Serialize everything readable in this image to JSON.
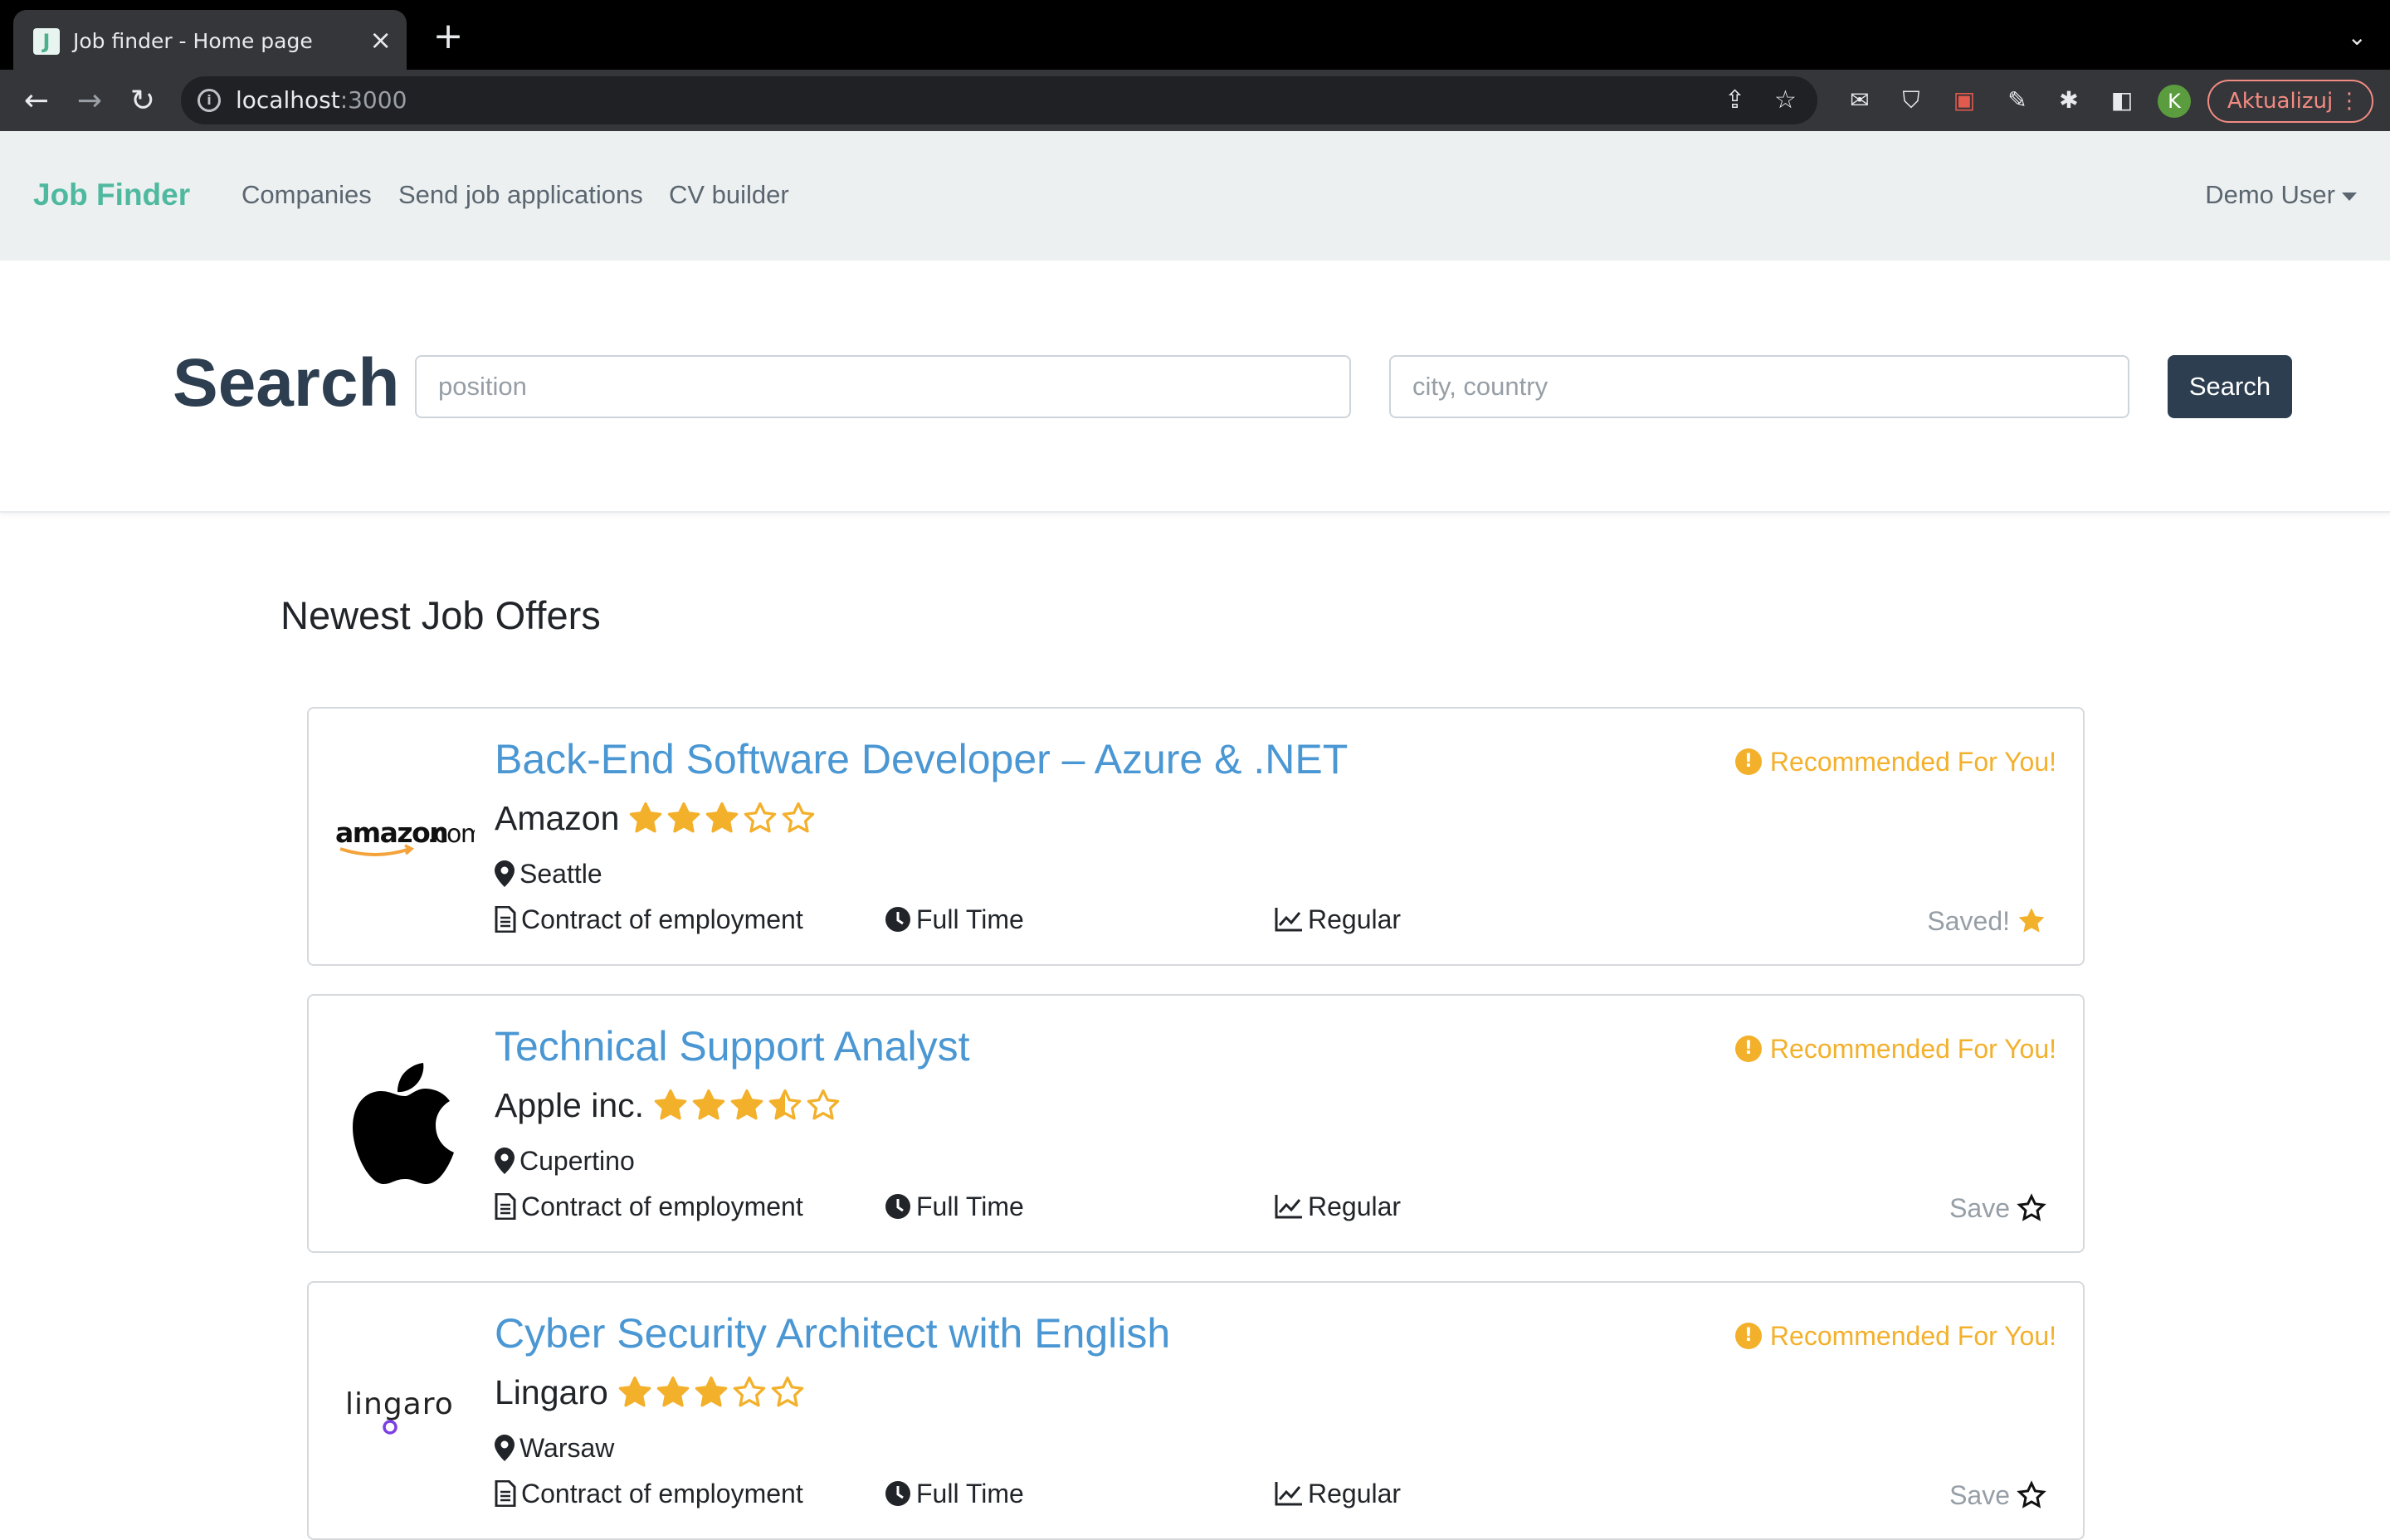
{
  "browser": {
    "tab_title": "Job finder - Home page",
    "favicon_letter": "J",
    "url_host": "localhost",
    "url_port": ":3000",
    "profile_initial": "K",
    "update_label": "Aktualizuj"
  },
  "navbar": {
    "brand": "Job Finder",
    "links": [
      "Companies",
      "Send job applications",
      "CV builder"
    ],
    "user": "Demo User"
  },
  "search": {
    "title": "Search",
    "position_placeholder": "position",
    "location_placeholder": "city, country",
    "button_label": "Search"
  },
  "offers": {
    "section_title": "Newest Job Offers",
    "items": [
      {
        "title": "Back-End Software Developer – Azure & .NET",
        "company": "Amazon",
        "rating": 3,
        "logo": "amazon.com",
        "city": "Seattle",
        "contract": "Contract of employment",
        "time": "Full Time",
        "level": "Regular",
        "recommended": "Recommended For You!",
        "save_label": "Saved!",
        "saved": true
      },
      {
        "title": "Technical Support Analyst",
        "company": "Apple inc.",
        "rating": 3.5,
        "logo": "apple-logo",
        "city": "Cupertino",
        "contract": "Contract of employment",
        "time": "Full Time",
        "level": "Regular",
        "recommended": "Recommended For You!",
        "save_label": "Save",
        "saved": false
      },
      {
        "title": "Cyber Security Architect with English",
        "company": "Lingaro",
        "rating": 3,
        "logo": "lingaro",
        "city": "Warsaw",
        "contract": "Contract of employment",
        "time": "Full Time",
        "level": "Regular",
        "recommended": "Recommended For You!",
        "save_label": "Save",
        "saved": false
      }
    ]
  },
  "colors": {
    "brand": "#4fb99f",
    "link": "#4a97d3",
    "star": "#f3b02b",
    "primary": "#2c3e50",
    "navbar_bg": "#ecf0f1"
  }
}
